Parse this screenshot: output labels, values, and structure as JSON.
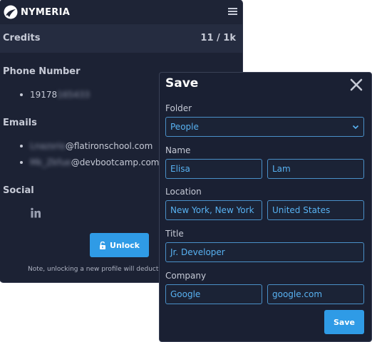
{
  "app": {
    "name": "NYMERIA"
  },
  "credits": {
    "label": "Credits",
    "value": "11 / 1k"
  },
  "phone": {
    "title": "Phone Number",
    "items": [
      {
        "visible": "19178",
        "hidden": "165433"
      }
    ]
  },
  "emails": {
    "title": "Emails",
    "items": [
      {
        "hidden": "Lnazsrio",
        "visible": "@flatironschool.com"
      },
      {
        "hidden": "Mk_Zkfue",
        "visible": "@devbootcamp.com"
      }
    ]
  },
  "social": {
    "title": "Social",
    "icons": [
      "linkedin-icon"
    ]
  },
  "unlock": {
    "label": "Unlock"
  },
  "note": "Note, unlocking a new profile will deduct",
  "modal": {
    "title": "Save",
    "folder": {
      "label": "Folder",
      "value": "People"
    },
    "name": {
      "label": "Name",
      "first": "Elisa",
      "last": "Lam"
    },
    "location": {
      "label": "Location",
      "city": "New York, New York",
      "country": "United States"
    },
    "title_field": {
      "label": "Title",
      "value": "Jr. Developer"
    },
    "company": {
      "label": "Company",
      "name": "Google",
      "domain": "google.com"
    },
    "save_label": "Save"
  },
  "colors": {
    "accent": "#2f9be6",
    "panel": "#1c2234",
    "input_text": "#58b2f2"
  }
}
